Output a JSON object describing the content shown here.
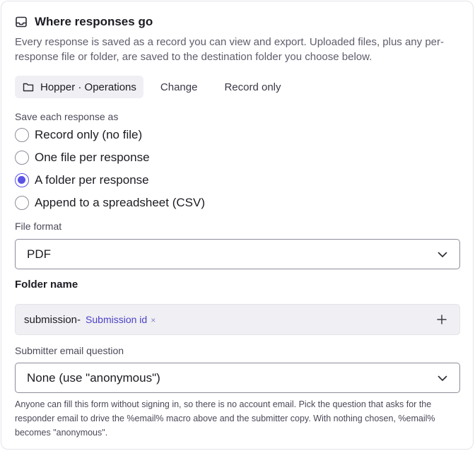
{
  "header": {
    "icon": "inbox-tray-icon",
    "title": "Where responses go"
  },
  "intro": "Every response is saved as a record you can view and export. Uploaded files, plus any per-response file or folder, are saved to the destination folder you choose below.",
  "destination": {
    "icon": "folder-icon",
    "folder_label": "Hopper · Operations",
    "change_label": "Change",
    "record_only_label": "Record only"
  },
  "save_as": {
    "label": "Save each response as",
    "options": [
      {
        "label": "Record only (no file)",
        "checked": false
      },
      {
        "label": "One file per response",
        "checked": false
      },
      {
        "label": "A folder per response",
        "checked": true
      },
      {
        "label": "Append to a spreadsheet (CSV)",
        "checked": false
      }
    ]
  },
  "file_format": {
    "label": "File format",
    "value": "PDF"
  },
  "folder_name": {
    "label": "Folder name",
    "prefix": "submission-",
    "token": "Submission id",
    "remove_glyph": "×"
  },
  "submitter_email": {
    "label": "Submitter email question",
    "value": "None (use \"anonymous\")",
    "help": "Anyone can fill this form without signing in, so there is no account email. Pick the question that asks for the responder email to drive the %email% macro above and the submitter copy. With nothing chosen, %email% becomes \"anonymous\"."
  },
  "colors": {
    "accent": "#5b52e6",
    "token_text": "#4b43c8",
    "chip_bg": "#f0eff3"
  }
}
